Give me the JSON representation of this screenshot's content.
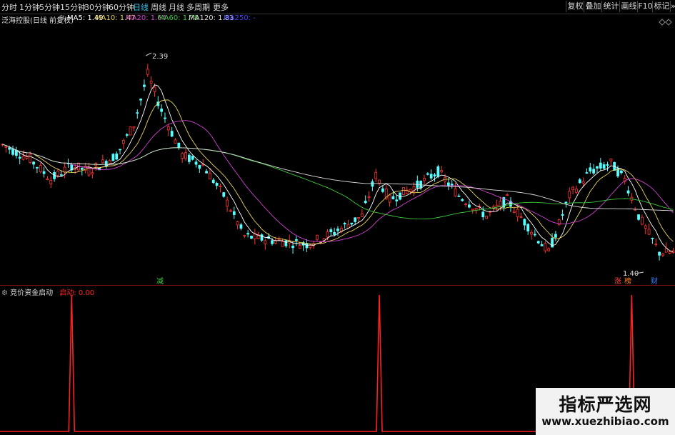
{
  "toolbar": {
    "periods": [
      "分时",
      "1分钟",
      "5分钟",
      "15分钟",
      "30分钟",
      "60分钟",
      "日线",
      "周线",
      "月线",
      "多周期",
      "更多"
    ],
    "active_period": "日线",
    "right_buttons": [
      "复权",
      "叠加",
      "统计",
      "画线",
      "F10",
      "标记"
    ],
    "icons": {
      "gear": "⚙",
      "more": "»"
    }
  },
  "main_chart": {
    "title": "泛海控股(日线 前复权)",
    "ma": [
      {
        "label": "MA5: 1.49",
        "color": "#ffffff"
      },
      {
        "label": "MA10: 1.47",
        "color": "#e8d25a"
      },
      {
        "label": "MA20: 1.64",
        "color": "#d040d0"
      },
      {
        "label": "MA60: 1.78",
        "color": "#3ac83a"
      },
      {
        "label": "MA120: 1.83",
        "color": "#dddddd"
      },
      {
        "label": "MA250: -",
        "color": "#4040ff"
      }
    ],
    "high_label": "2.39",
    "low_label": "1.40",
    "markers": [
      {
        "text": "减",
        "color": "#40d040"
      },
      {
        "text": "涨",
        "color": "#ff4040"
      },
      {
        "text": "榜",
        "color": "#ff8000"
      },
      {
        "text": "财",
        "color": "#4080ff"
      }
    ]
  },
  "sub_chart": {
    "title": "竞价资金启动",
    "indicator_label": "启动: 0.00",
    "indicator_color": "#ff2020",
    "spikes": [
      {
        "bar": 20,
        "value": 1
      },
      {
        "bar": 109,
        "value": 1
      },
      {
        "bar": 182,
        "value": 1
      }
    ]
  },
  "watermark": {
    "line1": "指标严选网",
    "line2": "www.xuezhibiao.com"
  }
}
